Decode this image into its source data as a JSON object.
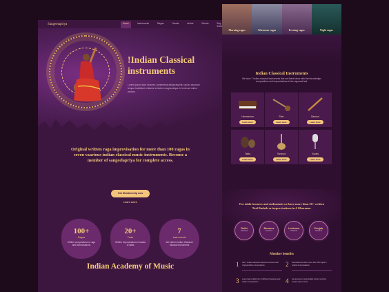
{
  "nav": {
    "brand": "Sangeetapriya",
    "links": [
      "Home",
      "Instruments",
      "Ragas",
      "Vocals",
      "Artists",
      "Events",
      "Buy Instruments"
    ]
  },
  "hero": {
    "title": "!Indian Classical instruments",
    "description": "Lorem ipsum dolor sit amet, consectetur adipiscing elit, sed do eiusmod tempor incididunt ut labore et dolore magna aliqua. Ut enim ad minim veniam."
  },
  "join": {
    "text": "Original written raga improvisation for more than 100 ragas in seven vaarious indian classical music instruments. Become a member of sangeelapriya for complete access.",
    "cta_label": "Get Membership now",
    "learn_label": "Learn more"
  },
  "stats": [
    {
      "number": "100+",
      "label": "Ragas",
      "desc": "Written compositions in raga and improvisations"
    },
    {
      "number": "20+",
      "label": "Taals",
      "desc": "Written improvisations in taalas of tabla"
    },
    {
      "number": "7",
      "label": "Instruments",
      "desc": "We believe Indian Classical Musical Instruments"
    }
  ],
  "academy_title": "Indian Academy of Music",
  "ragas": [
    {
      "label": "Morning ragas",
      "color": "#8a5a5a"
    },
    {
      "label": "Afternoon ragas",
      "color": "#5a5a7a"
    },
    {
      "label": "Evening ragas",
      "color": "#6a4a6e"
    },
    {
      "label": "Night ragas",
      "color": "#234a4a"
    }
  ],
  "instruments_section": {
    "title": "Indian Classical Instruments",
    "subtitle": "We have 7 Indian classical instruments that are listed below with their knowledge, compositions and improvisations in the raga and taal.",
    "items": [
      {
        "name": "Harmonium",
        "button": "Learn more"
      },
      {
        "name": "Sitar",
        "button": "Learn more"
      },
      {
        "name": "Bansuri",
        "button": "Learn more"
      },
      {
        "name": "Tabla",
        "button": "Learn more"
      },
      {
        "name": "Tanpura",
        "button": "Learn more"
      },
      {
        "name": "Vocals",
        "button": "Learn more"
      }
    ]
  },
  "gharana_section": {
    "text": "For tabla learners and enthusiasts we have more than 20+ written Taal Badatk or improvisations in 4 Gharanas.",
    "items": [
      {
        "name": "Delhi",
        "sub": "Gharana"
      },
      {
        "name": "Benares",
        "sub": "Gharana"
      },
      {
        "name": "Lucknow",
        "sub": "Gharana"
      },
      {
        "name": "Punjab",
        "sub": "Gharana"
      }
    ]
  },
  "benefits": {
    "title": "Member benefits",
    "items": [
      {
        "num": "1",
        "text": "Get 7 Indian classical instruments access with original written compositions."
      },
      {
        "num": "2",
        "text": "Download and listen more than 100 ragas in original improvisations."
      },
      {
        "num": "3",
        "text": "Learn taal in tabla from 4 different gharanas and written compositions."
      },
      {
        "num": "4",
        "text": "Get access to newly added content and live master class events."
      }
    ]
  }
}
